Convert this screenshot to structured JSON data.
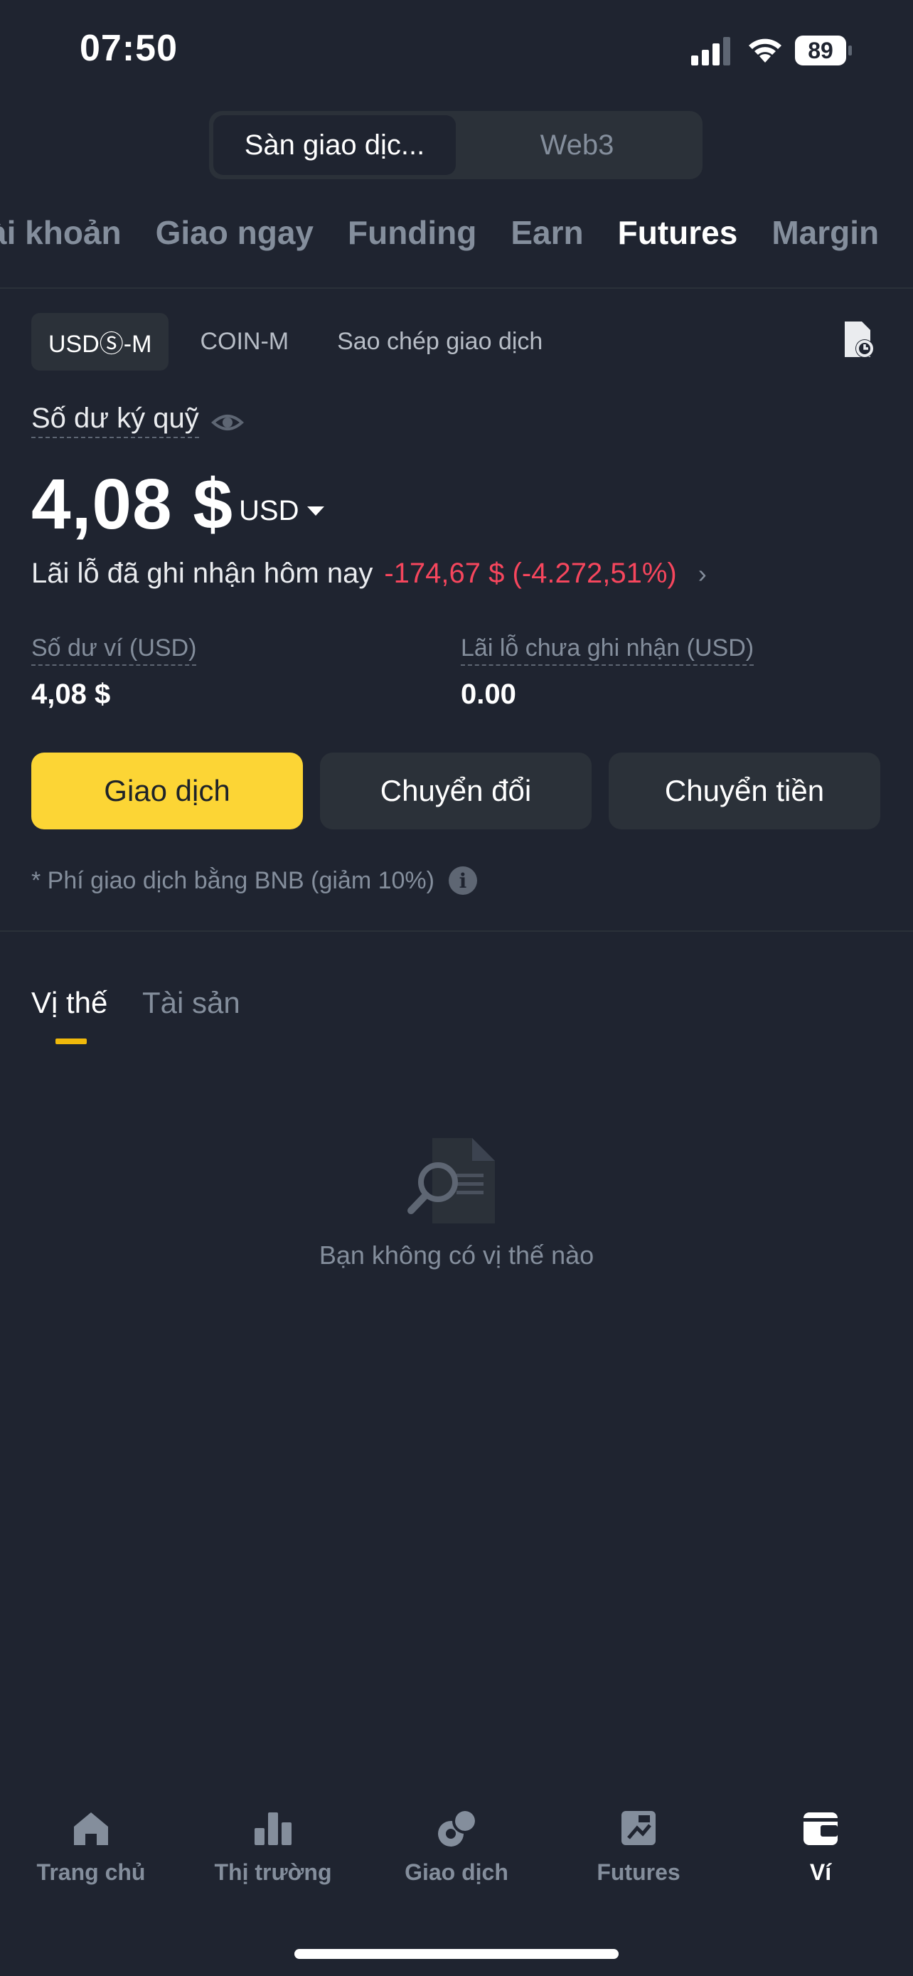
{
  "status_bar": {
    "time": "07:50",
    "battery": "89"
  },
  "segmented": {
    "exchange": "Sàn giao dịc...",
    "web3": "Web3"
  },
  "top_tabs": [
    "ài khoản",
    "Giao ngay",
    "Funding",
    "Earn",
    "Futures",
    "Margin"
  ],
  "sub_tabs": [
    "USDⓈ-M",
    "COIN-M",
    "Sao chép giao dịch"
  ],
  "margin_balance": {
    "label": "Số dư ký quỹ",
    "value": "4,08 $",
    "currency": "USD"
  },
  "pnl_today": {
    "label": "Lãi lỗ đã ghi nhận hôm nay",
    "value": "-174,67 $ (-4.272,51%)"
  },
  "stats": {
    "wallet_label": "Số dư ví (USD)",
    "wallet_value": "4,08 $",
    "unrealized_label": "Lãi lỗ chưa ghi nhận (USD)",
    "unrealized_value": "0.00"
  },
  "actions": {
    "trade": "Giao dịch",
    "convert": "Chuyển đổi",
    "transfer": "Chuyển tiền"
  },
  "fee_note": "*  Phí giao dịch bằng BNB (giảm 10%)",
  "position_tabs": {
    "positions": "Vị thế",
    "assets": "Tài sản"
  },
  "empty_state": "Bạn không có vị thế nào",
  "bottom_nav": [
    "Trang chủ",
    "Thị trường",
    "Giao dịch",
    "Futures",
    "Ví"
  ],
  "colors": {
    "background": "#1f2430",
    "accent": "#fcd535",
    "negative": "#f6465d",
    "muted": "#848e9c"
  }
}
